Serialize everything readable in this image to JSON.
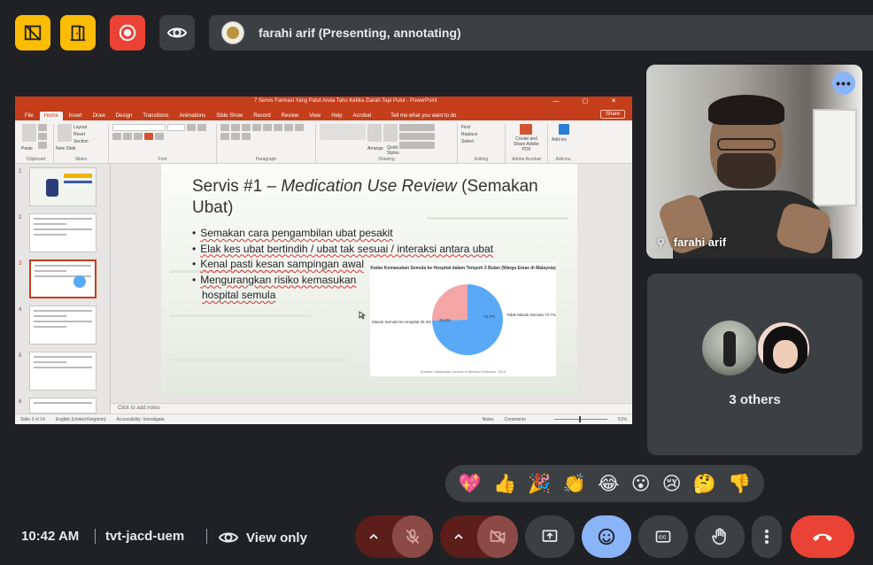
{
  "top_bar": {
    "buttons": [
      {
        "name": "layout-off-icon",
        "color": "#fbbc04"
      },
      {
        "name": "door-icon",
        "color": "#fbbc04"
      },
      {
        "name": "record-icon",
        "color": "#ea4335"
      },
      {
        "name": "eye-icon",
        "color": "#3c4043"
      }
    ],
    "presenter_label": "farahi arif (Presenting, annotating)"
  },
  "presentation": {
    "window_title": "7 Servis Farmasi Yang Patut Anda Tahu Ketika Ziarah Tapi Pulut - PowerPoint",
    "tabs": [
      "File",
      "Home",
      "Insert",
      "Draw",
      "Design",
      "Transitions",
      "Animations",
      "Slide Show",
      "Record",
      "Review",
      "View",
      "Help",
      "Acrobat"
    ],
    "active_tab": "Home",
    "tell_me": "Tell me what you want to do",
    "share_label": "Share",
    "ribbon_groups": [
      "Clipboard",
      "Slides",
      "Font",
      "Paragraph",
      "Drawing",
      "Editing",
      "Adobe Acrobat",
      "Add-ins"
    ],
    "ribbon_texts": {
      "paste": "Paste",
      "new_slide": "New Slide",
      "layout": "Layout",
      "reset": "Reset",
      "section": "Section",
      "arrange": "Arrange",
      "quick_styles": "Quick Styles",
      "find": "Find",
      "replace": "Replace",
      "select": "Select",
      "create_share": "Create and Share Adobe PDF",
      "add_ins": "Add-ins"
    },
    "thumbnail_numbers": [
      "1",
      "2",
      "3",
      "4",
      "5",
      "6"
    ],
    "slide": {
      "title_prefix": "Servis #1 – ",
      "title_italic": "Medication Use Review",
      "title_suffix": " (Semakan Ubat)",
      "bullets": [
        "Semakan cara pengambilan ubat pesakit",
        "Elak kes ubat bertindih / ubat tak sesuai / interaksi antara ubat",
        "Kenal pasti kesan sampingan awal",
        "Mengurangkan risiko kemasukan",
        "hospital semula"
      ]
    },
    "chart_data": {
      "type": "pie",
      "title": "Kadar Kemasukan Semula ke Hospital dalam Tempoh 3 Bulan (Warga Emas di Malaysia)",
      "categories": [
        "Tidak Masuk Semula",
        "Masuk Semula ke Hospital"
      ],
      "values": [
        74.7,
        25.3
      ],
      "label_left": "Masuk Semula ke Hospital 25.3%",
      "label_right": "Tidak Masuk Semula 74.7%",
      "inner_left": "25.3%",
      "inner_right": "74.7%",
      "colors": [
        "#5aa9f7",
        "#f4a6a6"
      ],
      "source": "Sumber: Malaysian Journal of Medical Sciences, 2019"
    },
    "notes_placeholder": "Click to add notes",
    "status": {
      "slide_of": "Slide 3 of 14",
      "language": "English (United Kingdom)",
      "accessibility": "Accessibility: Investigate",
      "notes": "Notes",
      "comments": "Comments",
      "zoom": "51%"
    }
  },
  "participants": {
    "main_name": "farahi arif",
    "others_label": "3 others"
  },
  "reactions": [
    "💖",
    "👍",
    "🎉",
    "👏",
    "😂",
    "😮",
    "😢",
    "🤔",
    "👎"
  ],
  "bottom_bar": {
    "time": "10:42 AM",
    "meeting_code": "tvt-jacd-uem",
    "view_mode": "View only",
    "end_call_color": "#ea4335"
  }
}
